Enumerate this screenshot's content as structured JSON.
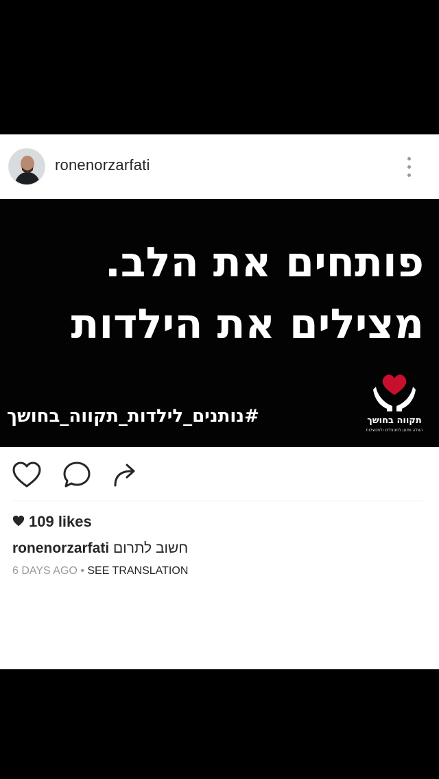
{
  "post": {
    "username": "ronenorzarfati",
    "avatar_icon": "profile-photo",
    "more_icon": "vertical-ellipsis-icon",
    "image": {
      "headline_line1": "פותחים את הלב.",
      "headline_line2": "מצילים את הילדות",
      "hashtag": "#נותנים_לילדות_תקווה_בחושך",
      "logo_title": "תקווה בחושך",
      "logo_subtitle": "הצלה ומיגון למנוצלים ולמנוצלות",
      "logo_icon": "heart-in-hands-icon",
      "logo_heart_color": "#c8102e"
    },
    "actions": {
      "like_icon": "heart-outline-icon",
      "comment_icon": "comment-bubble-icon",
      "share_icon": "share-arrow-icon"
    },
    "likes_text": "109 likes",
    "caption_user": "ronenorzarfati",
    "caption_text": "חשוב לתרום",
    "time_ago": "6 DAYS AGO",
    "separator": "•",
    "see_translation": "SEE TRANSLATION"
  }
}
